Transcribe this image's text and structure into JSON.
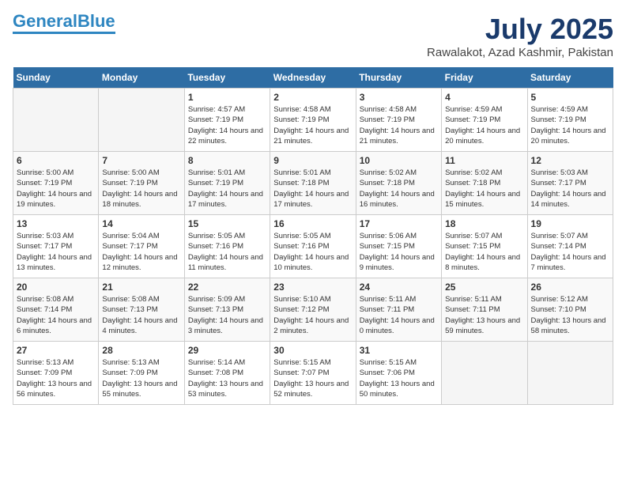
{
  "header": {
    "logo_line1": "General",
    "logo_line2": "Blue",
    "month_year": "July 2025",
    "location": "Rawalakot, Azad Kashmir, Pakistan"
  },
  "days_of_week": [
    "Sunday",
    "Monday",
    "Tuesday",
    "Wednesday",
    "Thursday",
    "Friday",
    "Saturday"
  ],
  "weeks": [
    [
      {
        "day": "",
        "sunrise": "",
        "sunset": "",
        "daylight": ""
      },
      {
        "day": "",
        "sunrise": "",
        "sunset": "",
        "daylight": ""
      },
      {
        "day": "1",
        "sunrise": "Sunrise: 4:57 AM",
        "sunset": "Sunset: 7:19 PM",
        "daylight": "Daylight: 14 hours and 22 minutes."
      },
      {
        "day": "2",
        "sunrise": "Sunrise: 4:58 AM",
        "sunset": "Sunset: 7:19 PM",
        "daylight": "Daylight: 14 hours and 21 minutes."
      },
      {
        "day": "3",
        "sunrise": "Sunrise: 4:58 AM",
        "sunset": "Sunset: 7:19 PM",
        "daylight": "Daylight: 14 hours and 21 minutes."
      },
      {
        "day": "4",
        "sunrise": "Sunrise: 4:59 AM",
        "sunset": "Sunset: 7:19 PM",
        "daylight": "Daylight: 14 hours and 20 minutes."
      },
      {
        "day": "5",
        "sunrise": "Sunrise: 4:59 AM",
        "sunset": "Sunset: 7:19 PM",
        "daylight": "Daylight: 14 hours and 20 minutes."
      }
    ],
    [
      {
        "day": "6",
        "sunrise": "Sunrise: 5:00 AM",
        "sunset": "Sunset: 7:19 PM",
        "daylight": "Daylight: 14 hours and 19 minutes."
      },
      {
        "day": "7",
        "sunrise": "Sunrise: 5:00 AM",
        "sunset": "Sunset: 7:19 PM",
        "daylight": "Daylight: 14 hours and 18 minutes."
      },
      {
        "day": "8",
        "sunrise": "Sunrise: 5:01 AM",
        "sunset": "Sunset: 7:19 PM",
        "daylight": "Daylight: 14 hours and 17 minutes."
      },
      {
        "day": "9",
        "sunrise": "Sunrise: 5:01 AM",
        "sunset": "Sunset: 7:18 PM",
        "daylight": "Daylight: 14 hours and 17 minutes."
      },
      {
        "day": "10",
        "sunrise": "Sunrise: 5:02 AM",
        "sunset": "Sunset: 7:18 PM",
        "daylight": "Daylight: 14 hours and 16 minutes."
      },
      {
        "day": "11",
        "sunrise": "Sunrise: 5:02 AM",
        "sunset": "Sunset: 7:18 PM",
        "daylight": "Daylight: 14 hours and 15 minutes."
      },
      {
        "day": "12",
        "sunrise": "Sunrise: 5:03 AM",
        "sunset": "Sunset: 7:17 PM",
        "daylight": "Daylight: 14 hours and 14 minutes."
      }
    ],
    [
      {
        "day": "13",
        "sunrise": "Sunrise: 5:03 AM",
        "sunset": "Sunset: 7:17 PM",
        "daylight": "Daylight: 14 hours and 13 minutes."
      },
      {
        "day": "14",
        "sunrise": "Sunrise: 5:04 AM",
        "sunset": "Sunset: 7:17 PM",
        "daylight": "Daylight: 14 hours and 12 minutes."
      },
      {
        "day": "15",
        "sunrise": "Sunrise: 5:05 AM",
        "sunset": "Sunset: 7:16 PM",
        "daylight": "Daylight: 14 hours and 11 minutes."
      },
      {
        "day": "16",
        "sunrise": "Sunrise: 5:05 AM",
        "sunset": "Sunset: 7:16 PM",
        "daylight": "Daylight: 14 hours and 10 minutes."
      },
      {
        "day": "17",
        "sunrise": "Sunrise: 5:06 AM",
        "sunset": "Sunset: 7:15 PM",
        "daylight": "Daylight: 14 hours and 9 minutes."
      },
      {
        "day": "18",
        "sunrise": "Sunrise: 5:07 AM",
        "sunset": "Sunset: 7:15 PM",
        "daylight": "Daylight: 14 hours and 8 minutes."
      },
      {
        "day": "19",
        "sunrise": "Sunrise: 5:07 AM",
        "sunset": "Sunset: 7:14 PM",
        "daylight": "Daylight: 14 hours and 7 minutes."
      }
    ],
    [
      {
        "day": "20",
        "sunrise": "Sunrise: 5:08 AM",
        "sunset": "Sunset: 7:14 PM",
        "daylight": "Daylight: 14 hours and 6 minutes."
      },
      {
        "day": "21",
        "sunrise": "Sunrise: 5:08 AM",
        "sunset": "Sunset: 7:13 PM",
        "daylight": "Daylight: 14 hours and 4 minutes."
      },
      {
        "day": "22",
        "sunrise": "Sunrise: 5:09 AM",
        "sunset": "Sunset: 7:13 PM",
        "daylight": "Daylight: 14 hours and 3 minutes."
      },
      {
        "day": "23",
        "sunrise": "Sunrise: 5:10 AM",
        "sunset": "Sunset: 7:12 PM",
        "daylight": "Daylight: 14 hours and 2 minutes."
      },
      {
        "day": "24",
        "sunrise": "Sunrise: 5:11 AM",
        "sunset": "Sunset: 7:11 PM",
        "daylight": "Daylight: 14 hours and 0 minutes."
      },
      {
        "day": "25",
        "sunrise": "Sunrise: 5:11 AM",
        "sunset": "Sunset: 7:11 PM",
        "daylight": "Daylight: 13 hours and 59 minutes."
      },
      {
        "day": "26",
        "sunrise": "Sunrise: 5:12 AM",
        "sunset": "Sunset: 7:10 PM",
        "daylight": "Daylight: 13 hours and 58 minutes."
      }
    ],
    [
      {
        "day": "27",
        "sunrise": "Sunrise: 5:13 AM",
        "sunset": "Sunset: 7:09 PM",
        "daylight": "Daylight: 13 hours and 56 minutes."
      },
      {
        "day": "28",
        "sunrise": "Sunrise: 5:13 AM",
        "sunset": "Sunset: 7:09 PM",
        "daylight": "Daylight: 13 hours and 55 minutes."
      },
      {
        "day": "29",
        "sunrise": "Sunrise: 5:14 AM",
        "sunset": "Sunset: 7:08 PM",
        "daylight": "Daylight: 13 hours and 53 minutes."
      },
      {
        "day": "30",
        "sunrise": "Sunrise: 5:15 AM",
        "sunset": "Sunset: 7:07 PM",
        "daylight": "Daylight: 13 hours and 52 minutes."
      },
      {
        "day": "31",
        "sunrise": "Sunrise: 5:15 AM",
        "sunset": "Sunset: 7:06 PM",
        "daylight": "Daylight: 13 hours and 50 minutes."
      },
      {
        "day": "",
        "sunrise": "",
        "sunset": "",
        "daylight": ""
      },
      {
        "day": "",
        "sunrise": "",
        "sunset": "",
        "daylight": ""
      }
    ]
  ]
}
